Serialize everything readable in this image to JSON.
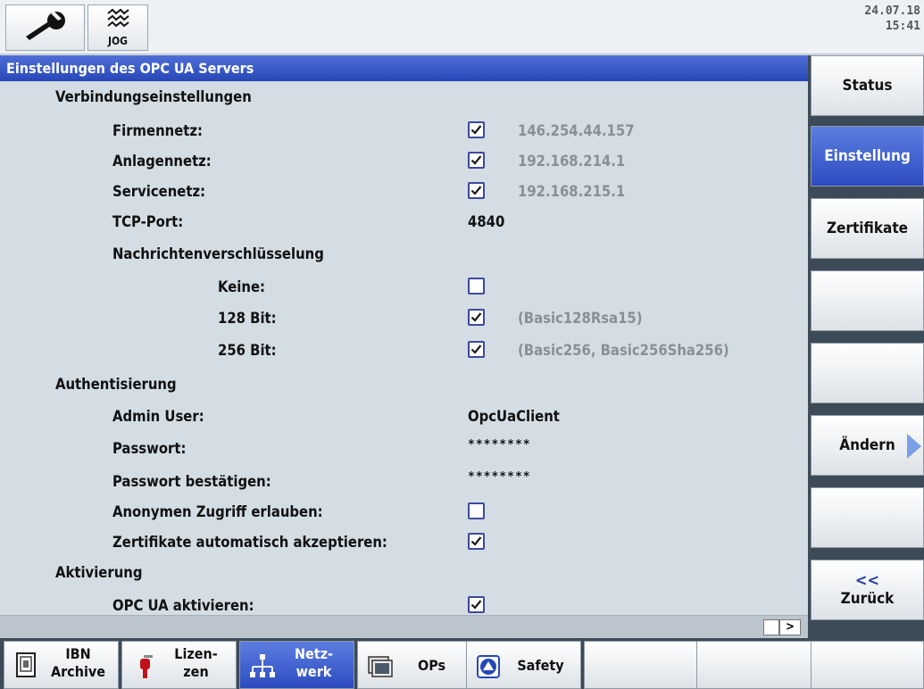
{
  "header": {
    "jog_label": "JOG",
    "date": "24.07.18",
    "time": "15:41"
  },
  "title": "Einstellungen des OPC UA Servers",
  "sections": {
    "connection": "Verbindungseinstellungen",
    "firmennetz_label": "Firmennetz:",
    "firmennetz_ip": "146.254.44.157",
    "anlagennetz_label": "Anlagennetz:",
    "anlagennetz_ip": "192.168.214.1",
    "servicenetz_label": "Servicenetz:",
    "servicenetz_ip": "192.168.215.1",
    "tcp_label": "TCP-Port:",
    "tcp_value": "4840",
    "encryption": "Nachrichtenverschlüsselung",
    "keine_label": "Keine:",
    "bit128_label": "128 Bit:",
    "bit128_value": "(Basic128Rsa15)",
    "bit256_label": "256 Bit:",
    "bit256_value": "(Basic256, Basic256Sha256)",
    "auth": "Authentisierung",
    "admin_label": "Admin User:",
    "admin_value": "OpcUaClient",
    "pw_label": "Passwort:",
    "pw_value": "********",
    "pw2_label": "Passwort bestätigen:",
    "pw2_value": "********",
    "anon_label": "Anonymen Zugriff erlauben:",
    "cert_label": "Zertifikate automatisch akzeptieren:",
    "activation": "Aktivierung",
    "opc_label": "OPC UA aktivieren:"
  },
  "checkboxes": {
    "firmennetz": true,
    "anlagennetz": true,
    "servicenetz": true,
    "keine": false,
    "bit128": true,
    "bit256": true,
    "anon": false,
    "cert": true,
    "opc": true
  },
  "vertical_keys": {
    "status": "Status",
    "einstellung": "Einstellung",
    "zertifikate": "Zertifikate",
    "aendern": "Ändern",
    "zurueck_arrow": "<<",
    "zurueck": "Zurück"
  },
  "horizontal_keys": {
    "ibn_line1": "IBN",
    "ibn_line2": "Archive",
    "lizenzen_line1": "Lizen-",
    "lizenzen_line2": "zen",
    "netzwerk_line1": "Netz-",
    "netzwerk_line2": "werk",
    "ops": "OPs",
    "safety": "Safety"
  },
  "scroll_arrow": ">",
  "colors": {
    "accent_blue": "#2747b8",
    "checkbox_border": "#3c4a9c",
    "gray_text": "#8a8f95"
  }
}
